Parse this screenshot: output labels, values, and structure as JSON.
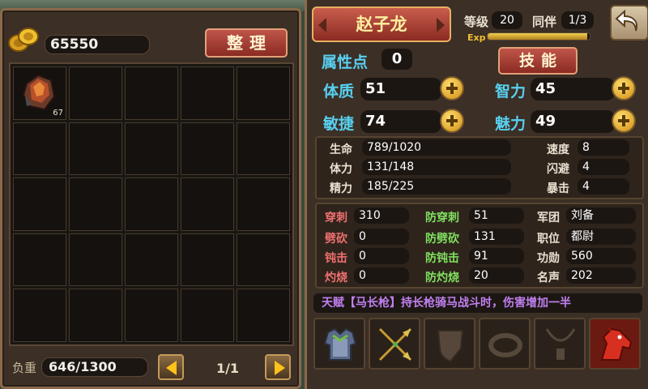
{
  "inventory": {
    "gold": "65550",
    "sort_label": "整理",
    "item_count": "67",
    "weight_label": "负重",
    "weight_value": "646/1300",
    "page": "1/1"
  },
  "character": {
    "name": "赵子龙",
    "level_label": "等级",
    "level": "20",
    "companion_label": "同伴",
    "companion": "1/3",
    "exp_label": "Exp",
    "exp_fraction": 0.98,
    "attr_points_label": "属性点",
    "attr_points": "0",
    "skill_label": "技能",
    "stats": [
      {
        "label": "体质",
        "value": "51"
      },
      {
        "label": "智力",
        "value": "45"
      },
      {
        "label": "敏捷",
        "value": "74"
      },
      {
        "label": "魅力",
        "value": "49"
      }
    ],
    "vitals": [
      {
        "label": "生命",
        "value": "789/1020"
      },
      {
        "label": "体力",
        "value": "131/148"
      },
      {
        "label": "精力",
        "value": "185/225"
      }
    ],
    "secondary": [
      {
        "label": "速度",
        "value": "8"
      },
      {
        "label": "闪避",
        "value": "4"
      },
      {
        "label": "暴击",
        "value": "4"
      }
    ],
    "attack": [
      {
        "label": "穿刺",
        "value": "310"
      },
      {
        "label": "劈砍",
        "value": "0"
      },
      {
        "label": "钝击",
        "value": "0"
      },
      {
        "label": "灼烧",
        "value": "0"
      }
    ],
    "defense": [
      {
        "label": "防穿刺",
        "value": "51"
      },
      {
        "label": "防劈砍",
        "value": "131"
      },
      {
        "label": "防钝击",
        "value": "91"
      },
      {
        "label": "防灼烧",
        "value": "20"
      }
    ],
    "info": [
      {
        "label": "军团",
        "value": "刘备"
      },
      {
        "label": "职位",
        "value": "都尉"
      },
      {
        "label": "功勋",
        "value": "560"
      },
      {
        "label": "名声",
        "value": "202"
      }
    ],
    "talent": "天赋【马长枪】持长枪骑马战斗时，伤害增加一半"
  },
  "colors": {
    "accent_red": "#8a2b22",
    "cyan_label": "#58d0f0",
    "gold": "#ffc21a",
    "talent_purple": "#c080f0"
  }
}
